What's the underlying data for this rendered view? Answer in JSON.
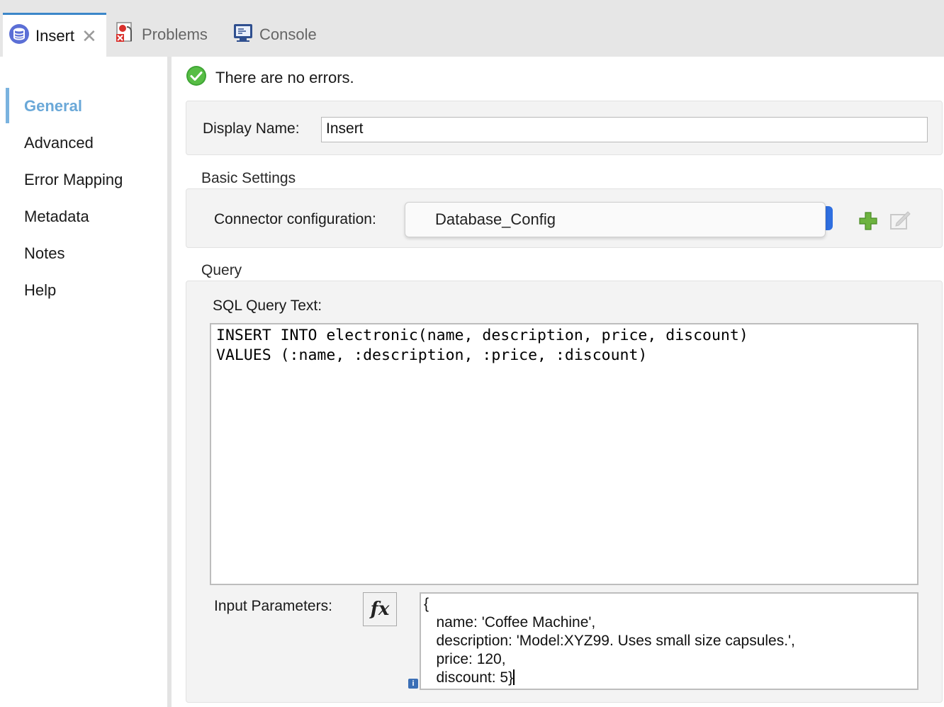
{
  "tabs": [
    {
      "label": "Insert",
      "icon": "database-icon",
      "active": true,
      "closable": true
    },
    {
      "label": "Problems",
      "icon": "problems-icon",
      "active": false
    },
    {
      "label": "Console",
      "icon": "console-icon",
      "active": false
    }
  ],
  "sidebar": {
    "items": [
      {
        "label": "General",
        "selected": true
      },
      {
        "label": "Advanced"
      },
      {
        "label": "Error Mapping"
      },
      {
        "label": "Metadata"
      },
      {
        "label": "Notes"
      },
      {
        "label": "Help"
      }
    ]
  },
  "status": {
    "text": "There are no errors.",
    "icon": "check-circle-icon",
    "color": "#3fa535"
  },
  "general": {
    "display_name_label": "Display Name:",
    "display_name_value": "Insert"
  },
  "basic_settings": {
    "title": "Basic Settings",
    "connector_label": "Connector configuration:",
    "connector_value": "Database_Config"
  },
  "query": {
    "title": "Query",
    "sql_label": "SQL Query Text:",
    "sql_text": "INSERT INTO electronic(name, description, price, discount)\nVALUES (:name, :description, :price, :discount)",
    "input_params_label": "Input Parameters:",
    "fx_label": "fx",
    "input_params_text": "{\n   name: 'Coffee Machine',\n   description: 'Model:XYZ99. Uses small size capsules.',\n   price: 120,\n   discount: 5}"
  },
  "colors": {
    "accent": "#3b87c9",
    "selected_nav": "#6aa8d8",
    "select_arrow": "#2f6fe0",
    "add_icon": "#6db33f"
  }
}
